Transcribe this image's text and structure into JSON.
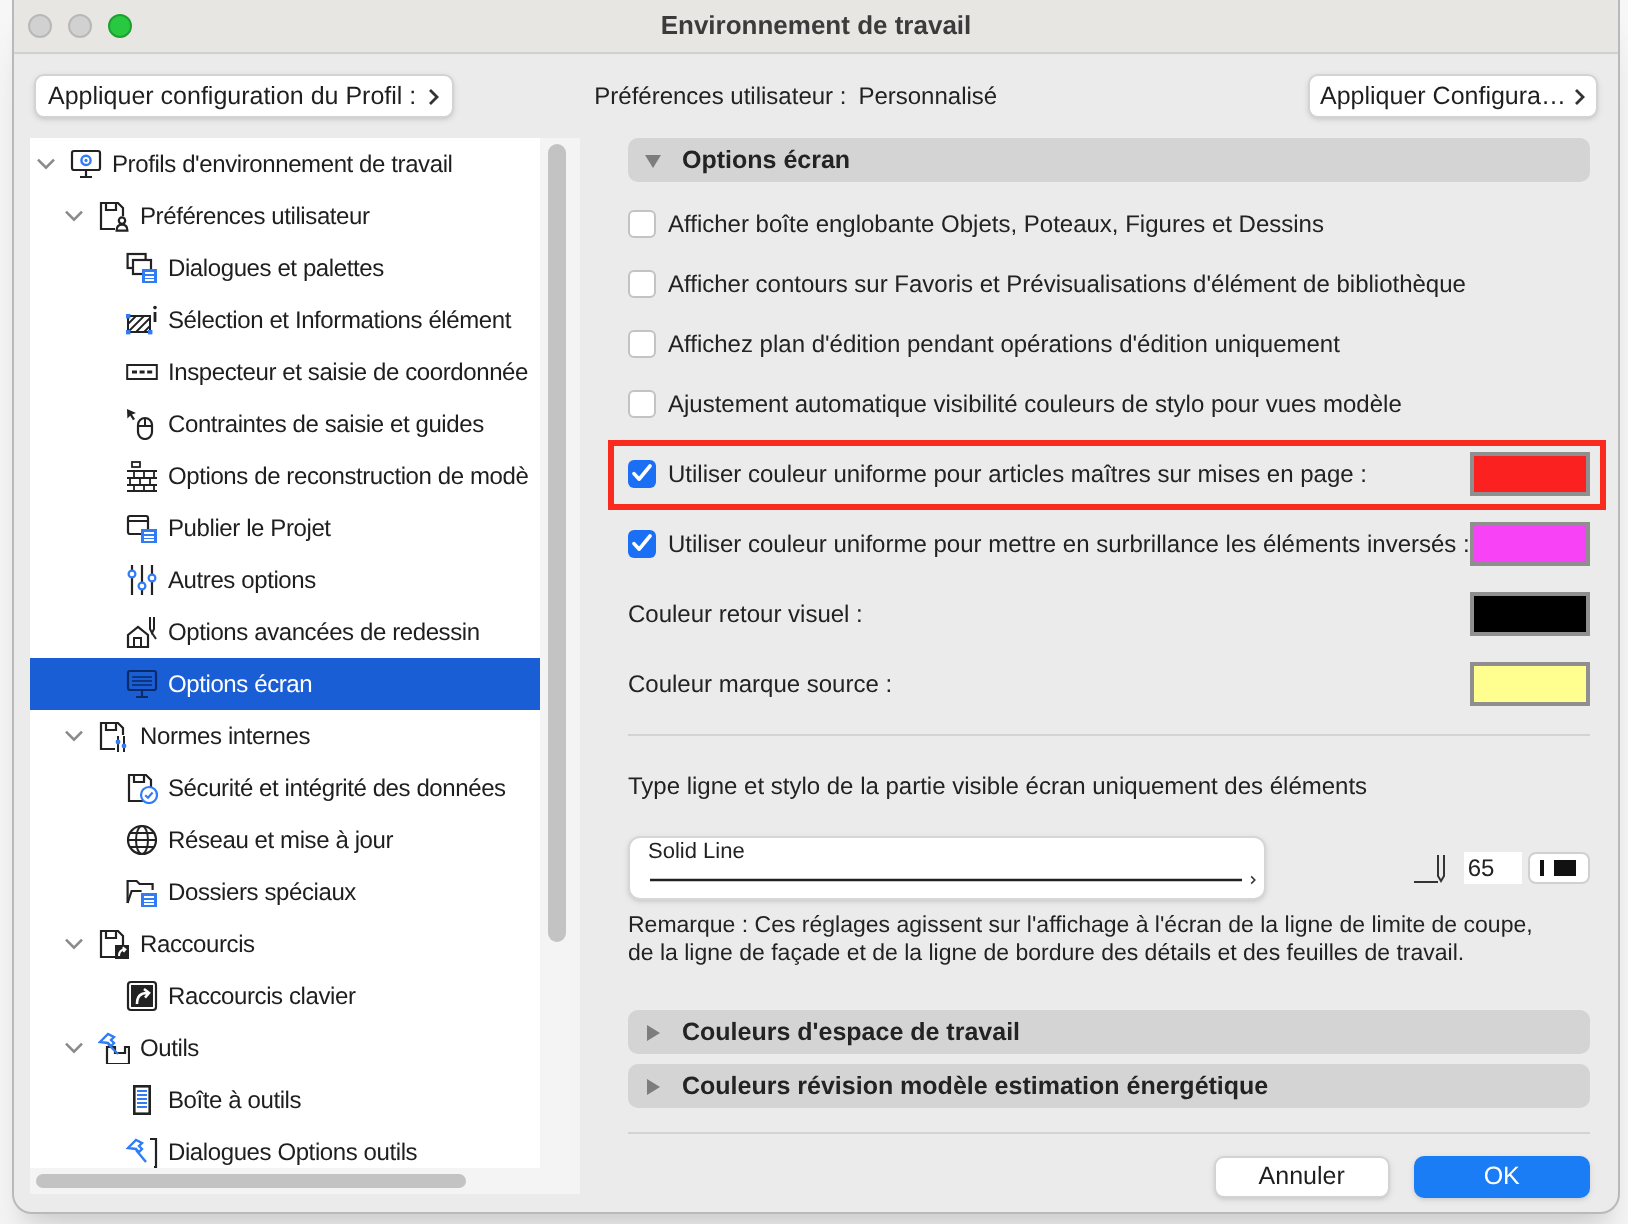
{
  "window": {
    "title": "Environnement de travail",
    "controls": [
      {
        "disabled": true
      },
      {
        "disabled": true
      },
      {
        "disabled": false
      }
    ]
  },
  "toolbar": {
    "profile_button": "Appliquer configuration du Profil :",
    "status_label": "Préférences utilisateur :",
    "status_value": "Personnalisé",
    "config_button": "Appliquer Configura…"
  },
  "tree": {
    "items": [
      {
        "label": "Profils d'environnement de travail",
        "expanded": true,
        "selected": false,
        "children": [
          {
            "label": "Préférences utilisateur",
            "expanded": true,
            "selected": false,
            "children": [
              {
                "label": "Dialogues et palettes",
                "selected": false
              },
              {
                "label": "Sélection et Informations élément",
                "selected": false
              },
              {
                "label": "Inspecteur et saisie de coordonnée",
                "selected": false
              },
              {
                "label": "Contraintes de saisie et guides",
                "selected": false
              },
              {
                "label": "Options de reconstruction de modè",
                "selected": false
              },
              {
                "label": "Publier le Projet",
                "selected": false
              },
              {
                "label": "Autres options",
                "selected": false
              },
              {
                "label": "Options avancées de redessin",
                "selected": false
              },
              {
                "label": "Options écran",
                "selected": true
              }
            ]
          },
          {
            "label": "Normes internes",
            "expanded": true,
            "selected": false,
            "children": [
              {
                "label": "Sécurité et intégrité des données",
                "selected": false
              },
              {
                "label": "Réseau et mise à jour",
                "selected": false
              },
              {
                "label": "Dossiers spéciaux",
                "selected": false
              }
            ]
          },
          {
            "label": "Raccourcis",
            "expanded": true,
            "selected": false,
            "children": [
              {
                "label": "Raccourcis clavier",
                "selected": false
              }
            ]
          },
          {
            "label": "Outils",
            "expanded": true,
            "selected": false,
            "children": [
              {
                "label": "Boîte à outils",
                "selected": false
              },
              {
                "label": "Dialogues Options outils",
                "selected": false
              }
            ]
          }
        ]
      }
    ]
  },
  "options_panel": {
    "section": {
      "title": "Options écran",
      "expanded": true
    },
    "options": [
      {
        "kind": "checkbox",
        "label": "Afficher boîte englobante Objets, Poteaux, Figures et Dessins",
        "checked": false,
        "highlighted": false
      },
      {
        "kind": "checkbox",
        "label": "Afficher contours sur Favoris et Prévisualisations d'élément de bibliothèque",
        "checked": false,
        "highlighted": false
      },
      {
        "kind": "checkbox",
        "label": "Affichez plan d'édition pendant opérations d'édition uniquement",
        "checked": false,
        "highlighted": false
      },
      {
        "kind": "checkbox",
        "label": "Ajustement automatique visibilité couleurs de stylo pour vues modèle",
        "checked": false,
        "highlighted": false
      },
      {
        "kind": "checkbox",
        "label": "Utiliser couleur uniforme pour articles maîtres sur mises en page :",
        "checked": true,
        "highlighted": true,
        "color": "#fc2121"
      },
      {
        "kind": "checkbox",
        "label": "Utiliser couleur uniforme pour mettre en surbrillance les éléments inversés :",
        "checked": true,
        "highlighted": false,
        "color": "#f743f5"
      },
      {
        "kind": "color",
        "label": "Couleur retour visuel :",
        "highlighted": false,
        "color": "#000000"
      },
      {
        "kind": "color",
        "label": "Couleur marque source :",
        "highlighted": false,
        "color": "#ffff8f"
      }
    ],
    "line_caption": "Type ligne et stylo de la partie visible écran uniquement des éléments",
    "line_type": "Solid Line",
    "pen_number": "65",
    "note": "Remarque : Ces réglages agissent sur l'affichage à l'écran de la ligne de limite de coupe, de la ligne de façade et de la ligne de bordure des détails et des feuilles de travail."
  },
  "more_sections": [
    {
      "title": "Couleurs d'espace de travail",
      "expanded": false
    },
    {
      "title": "Couleurs révision modèle estimation énergétique",
      "expanded": false
    }
  ],
  "buttons": [
    {
      "label": "Annuler",
      "default": false
    },
    {
      "label": "OK",
      "default": true
    }
  ]
}
